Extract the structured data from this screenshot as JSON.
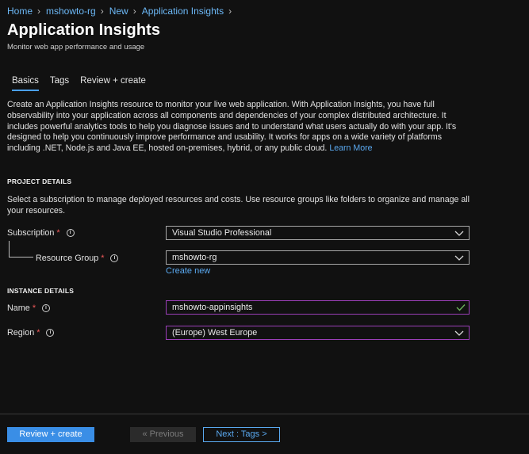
{
  "breadcrumb": [
    "Home",
    "mshowto-rg",
    "New",
    "Application Insights"
  ],
  "page": {
    "title": "Application Insights",
    "subtitle": "Monitor web app performance and usage"
  },
  "tabs": [
    {
      "label": "Basics",
      "active": true
    },
    {
      "label": "Tags",
      "active": false
    },
    {
      "label": "Review + create",
      "active": false
    }
  ],
  "description": {
    "text": "Create an Application Insights resource to monitor your live web application. With Application Insights, you have full observability into your application across all components and dependencies of your complex distributed architecture. It includes powerful analytics tools to help you diagnose issues and to understand what users actually do with your app. It's designed to help you continuously improve performance and usability. It works for apps on a wide variety of platforms including .NET, Node.js and Java EE, hosted on-premises, hybrid, or any public cloud.",
    "link": "Learn More"
  },
  "project": {
    "heading": "PROJECT DETAILS",
    "text": "Select a subscription to manage deployed resources and costs. Use resource groups like folders to organize and manage all your resources.",
    "subscription_label": "Subscription",
    "subscription_value": "Visual Studio Professional",
    "resource_group_label": "Resource Group",
    "resource_group_value": "mshowto-rg",
    "create_new": "Create new"
  },
  "instance": {
    "heading": "INSTANCE DETAILS",
    "name_label": "Name",
    "name_value": "mshowto-appinsights",
    "region_label": "Region",
    "region_value": "(Europe) West Europe"
  },
  "required_mark": "*",
  "footer": {
    "review_create": "Review + create",
    "previous": "« Previous",
    "next": "Next : Tags >"
  },
  "colors": {
    "background": "#111111",
    "link": "#5aa9f0",
    "primary_button": "#3a8ee6",
    "required": "#f25a5a",
    "focus_border": "#9b3fb8",
    "valid_check": "#6bb35a"
  }
}
